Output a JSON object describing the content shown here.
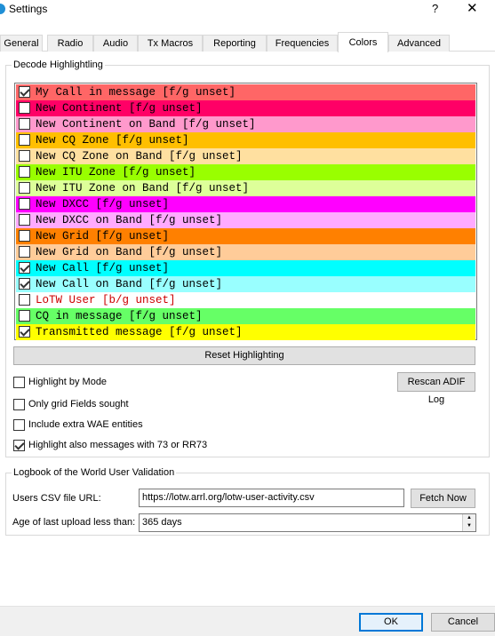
{
  "window": {
    "title": "Settings",
    "help_label": "?",
    "close_label": "✕"
  },
  "tabs": [
    {
      "label": "General"
    },
    {
      "label": "Radio"
    },
    {
      "label": "Audio"
    },
    {
      "label": "Tx Macros"
    },
    {
      "label": "Reporting"
    },
    {
      "label": "Frequencies"
    },
    {
      "label": "Colors"
    },
    {
      "label": "Advanced"
    }
  ],
  "active_tab": "Colors",
  "decode": {
    "legend": "Decode Highlightling",
    "items": [
      {
        "label": "My Call in message [f/g unset]",
        "bg": "#ff6666",
        "fg": "#000000",
        "checked": true
      },
      {
        "label": "New Continent [f/g unset]",
        "bg": "#ff0066",
        "fg": "#000000",
        "checked": false
      },
      {
        "label": "New Continent on Band [f/g unset]",
        "bg": "#ff99cc",
        "fg": "#000000",
        "checked": false
      },
      {
        "label": "New CQ Zone [f/g unset]",
        "bg": "#ffbf00",
        "fg": "#000000",
        "checked": false
      },
      {
        "label": "New CQ Zone on Band [f/g unset]",
        "bg": "#ffe0a0",
        "fg": "#000000",
        "checked": false
      },
      {
        "label": "New ITU Zone [f/g unset]",
        "bg": "#99ff00",
        "fg": "#000000",
        "checked": false
      },
      {
        "label": "New ITU Zone on Band [f/g unset]",
        "bg": "#ddff99",
        "fg": "#000000",
        "checked": false
      },
      {
        "label": "New DXCC [f/g unset]",
        "bg": "#ff00ff",
        "fg": "#000000",
        "checked": false
      },
      {
        "label": "New DXCC on Band [f/g unset]",
        "bg": "#ffaaff",
        "fg": "#000000",
        "checked": false
      },
      {
        "label": "New Grid [f/g unset]",
        "bg": "#ff8000",
        "fg": "#000000",
        "checked": false
      },
      {
        "label": "New Grid on Band [f/g unset]",
        "bg": "#ffcc99",
        "fg": "#000000",
        "checked": false
      },
      {
        "label": "New Call [f/g unset]",
        "bg": "#00ffff",
        "fg": "#000000",
        "checked": true
      },
      {
        "label": "New Call on Band [f/g unset]",
        "bg": "#99ffff",
        "fg": "#000000",
        "checked": true
      },
      {
        "label": "LoTW User [b/g unset]",
        "bg": "#ffffff",
        "fg": "#cc0000",
        "checked": false
      },
      {
        "label": "CQ in message [f/g unset]",
        "bg": "#66ff66",
        "fg": "#000000",
        "checked": false
      },
      {
        "label": "Transmitted message [f/g unset]",
        "bg": "#ffff00",
        "fg": "#000000",
        "checked": true
      }
    ],
    "reset_label": "Reset Highlighting",
    "rescan_label": "Rescan ADIF Log",
    "options": [
      {
        "label": "Highlight by Mode",
        "checked": false
      },
      {
        "label": "Only grid Fields sought",
        "checked": false
      },
      {
        "label": "Include extra WAE entities",
        "checked": false
      },
      {
        "label": "Highlight also messages with 73 or RR73",
        "checked": true
      }
    ]
  },
  "lotw": {
    "legend": "Logbook of the World User Validation",
    "csv_label": "Users CSV file URL:",
    "csv_value": "https://lotw.arrl.org/lotw-user-activity.csv",
    "fetch_label": "Fetch Now",
    "age_label": "Age of last upload less than:",
    "age_value": "365 days"
  },
  "footer": {
    "ok_label": "OK",
    "cancel_label": "Cancel"
  }
}
